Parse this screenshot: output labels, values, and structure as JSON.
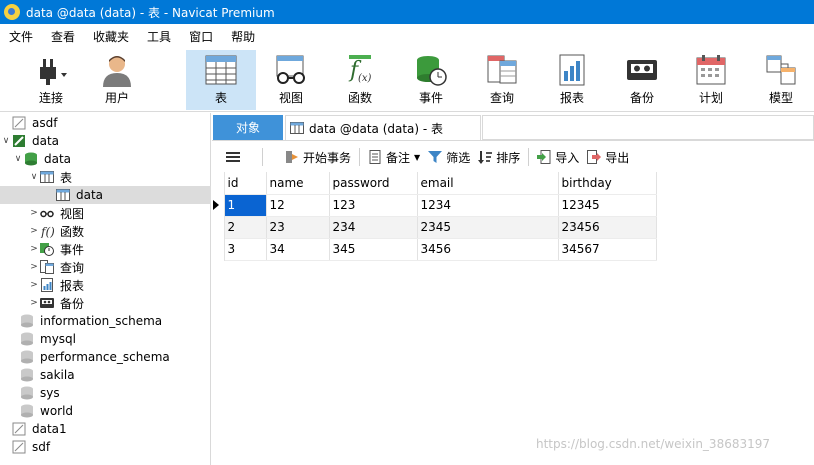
{
  "window": {
    "title": "data @data (data) - 表 - Navicat Premium"
  },
  "menu": [
    "文件",
    "查看",
    "收藏夹",
    "工具",
    "窗口",
    "帮助"
  ],
  "toolbar": {
    "connect": "连接",
    "user": "用户",
    "table": "表",
    "view": "视图",
    "function": "函数",
    "event": "事件",
    "query": "查询",
    "report": "报表",
    "backup": "备份",
    "schedule": "计划",
    "model": "模型"
  },
  "tree": {
    "asdf": "asdf",
    "data_conn": "data",
    "data_db": "data",
    "tables": "表",
    "data_table": "data",
    "views": "视图",
    "functions": "函数",
    "events": "事件",
    "queries": "查询",
    "reports": "报表",
    "backups": "备份",
    "information_schema": "information_schema",
    "mysql": "mysql",
    "performance_schema": "performance_schema",
    "sakila": "sakila",
    "sys": "sys",
    "world": "world",
    "data1": "data1",
    "sdf": "sdf"
  },
  "tabs": {
    "objects": "对象",
    "current": "data @data (data) - 表"
  },
  "subtoolbar": {
    "begin_transaction": "开始事务",
    "memo": "备注",
    "filter": "筛选",
    "sort": "排序",
    "import": "导入",
    "export": "导出"
  },
  "grid": {
    "columns": [
      "id",
      "name",
      "password",
      "email",
      "birthday"
    ],
    "rows": [
      [
        "1",
        "12",
        "123",
        "1234",
        "12345"
      ],
      [
        "2",
        "23",
        "234",
        "2345",
        "23456"
      ],
      [
        "3",
        "34",
        "345",
        "3456",
        "34567"
      ]
    ]
  },
  "watermark": "https://blog.csdn.net/weixin_38683197",
  "colors": {
    "titlebar": "#0078d7",
    "active_tab": "#3f92d9",
    "selected_cell": "#0a64d2",
    "active_tool": "#cce4f7"
  }
}
